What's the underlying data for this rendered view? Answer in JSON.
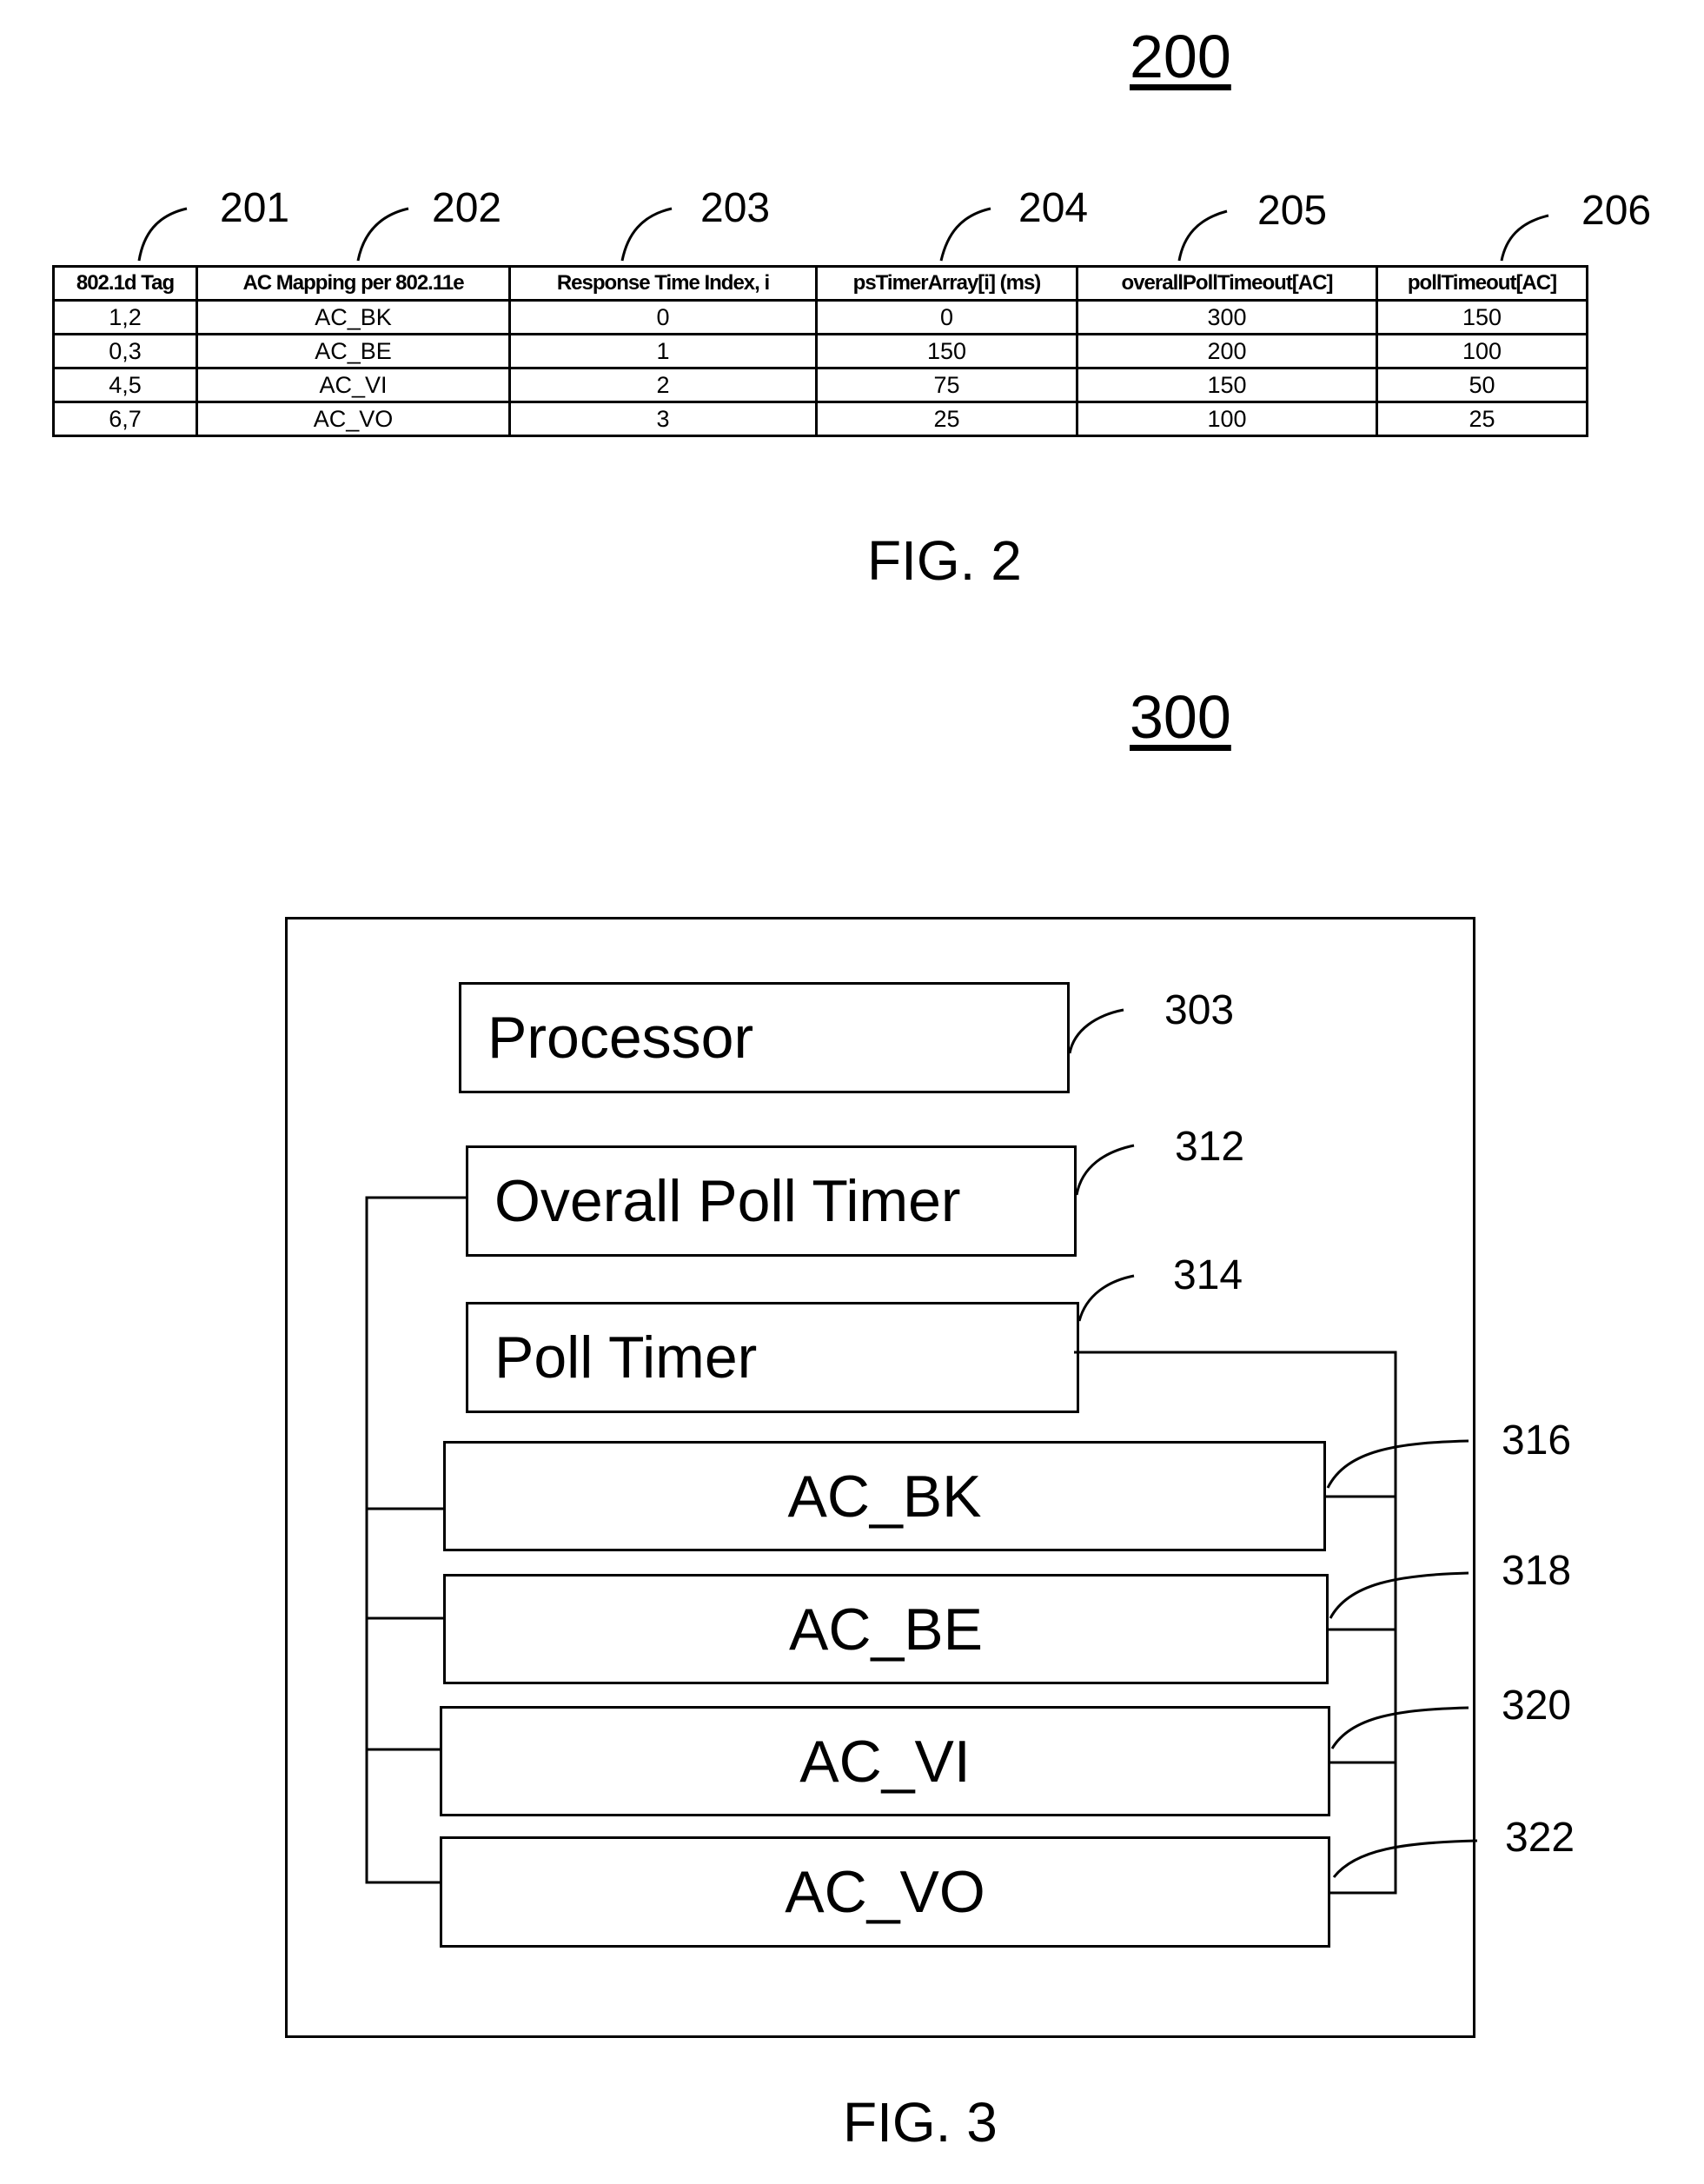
{
  "fig2": {
    "number": "200",
    "caption": "FIG. 2",
    "column_refs": [
      "201",
      "202",
      "203",
      "204",
      "205",
      "206"
    ],
    "table": {
      "headers": [
        "802.1d Tag",
        "AC Mapping per 802.11e",
        "Response Time Index, i",
        "psTimerArray[i] (ms)",
        "overallPollTimeout[AC]",
        "pollTimeout[AC]"
      ],
      "rows": [
        [
          "1,2",
          "AC_BK",
          "0",
          "0",
          "300",
          "150"
        ],
        [
          "0,3",
          "AC_BE",
          "1",
          "150",
          "200",
          "100"
        ],
        [
          "4,5",
          "AC_VI",
          "2",
          "75",
          "150",
          "50"
        ],
        [
          "6,7",
          "AC_VO",
          "3",
          "25",
          "100",
          "25"
        ]
      ]
    }
  },
  "fig3": {
    "number": "300",
    "caption": "FIG. 3",
    "blocks": [
      {
        "label": "Processor",
        "ref": "303"
      },
      {
        "label": "Overall Poll Timer",
        "ref": "312"
      },
      {
        "label": "Poll Timer",
        "ref": "314"
      },
      {
        "label": "AC_BK",
        "ref": "316"
      },
      {
        "label": "AC_BE",
        "ref": "318"
      },
      {
        "label": "AC_VI",
        "ref": "320"
      },
      {
        "label": "AC_VO",
        "ref": "322"
      }
    ]
  }
}
